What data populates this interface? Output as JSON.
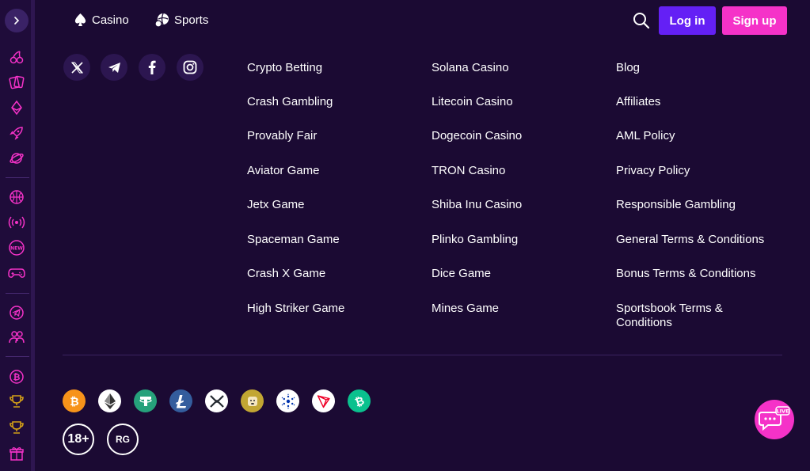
{
  "header": {
    "nav": [
      {
        "label": "Casino",
        "icon": "spade-icon"
      },
      {
        "label": "Sports",
        "icon": "balls-icon"
      }
    ],
    "login_label": "Log in",
    "signup_label": "Sign up"
  },
  "sidebar": {
    "icons": [
      "cherry-icon",
      "cards-icon",
      "ethereum-icon",
      "rocket-icon",
      "planet-icon",
      "basketball-icon",
      "live-signal-icon",
      "new-icon",
      "gamepad-icon",
      "telegram-icon",
      "users-icon",
      "bitcoin-icon",
      "trophy-icon",
      "trophy-icon",
      "gift-icon"
    ]
  },
  "socials": [
    "x-icon",
    "telegram-icon",
    "facebook-icon",
    "instagram-icon"
  ],
  "footer": {
    "col1": [
      "Crypto Betting",
      "Crash Gambling",
      "Provably Fair",
      "Aviator Game",
      "Jetx Game",
      "Spaceman Game",
      "Crash X Game",
      "High Striker Game"
    ],
    "col2": [
      "Solana Casino",
      "Litecoin Casino",
      "Dogecoin Casino",
      "TRON Casino",
      "Shiba Inu Casino",
      "Plinko Gambling",
      "Dice Game",
      "Mines Game"
    ],
    "col3": [
      "Blog",
      "Affiliates",
      "AML Policy",
      "Privacy Policy",
      "Responsible Gambling",
      "General Terms & Conditions",
      "Bonus Terms & Conditions",
      "Sportsbook Terms & Conditions"
    ]
  },
  "crypto": [
    {
      "name": "bitcoin-icon",
      "color": "#f7931a"
    },
    {
      "name": "ethereum-icon",
      "color": "#ffffff"
    },
    {
      "name": "tether-icon",
      "color": "#26a17b"
    },
    {
      "name": "litecoin-icon",
      "color": "#345d9d"
    },
    {
      "name": "xrp-icon",
      "color": "#ffffff"
    },
    {
      "name": "dogecoin-icon",
      "color": "#c2a633"
    },
    {
      "name": "cardano-icon",
      "color": "#ffffff"
    },
    {
      "name": "tron-icon",
      "color": "#ffffff"
    },
    {
      "name": "bitcoin-cash-icon",
      "color": "#0ac18e"
    }
  ],
  "badges": {
    "age": "18+",
    "rg": "RG"
  },
  "chat": {
    "label": "LIVE"
  },
  "colors": {
    "background": "#1b0a33",
    "accent_login": "#6420f5",
    "accent_signup": "#f532c8",
    "sidebar_icon": "#f532c8"
  }
}
